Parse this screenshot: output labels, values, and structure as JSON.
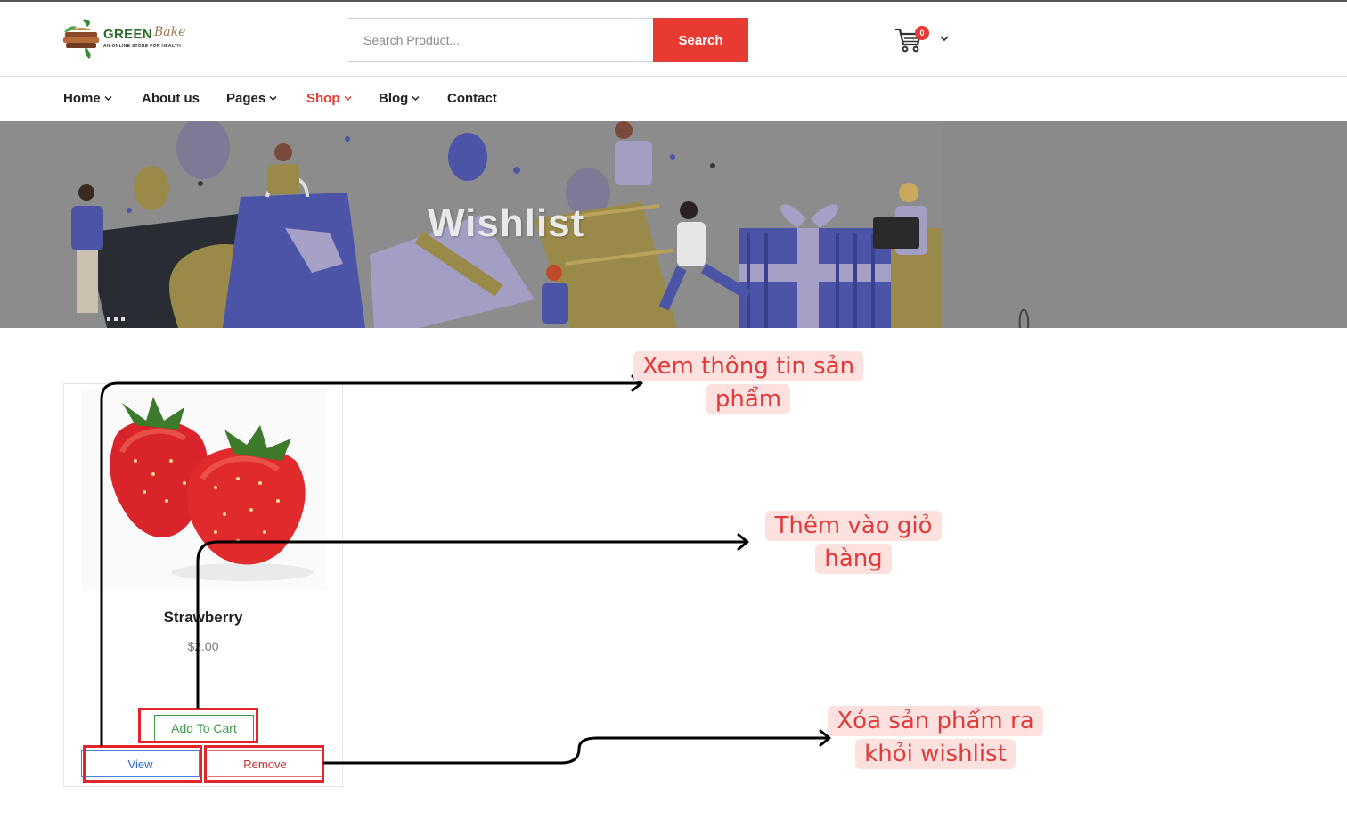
{
  "header": {
    "logo_text": "GREEN",
    "logo_script": "Bake",
    "logo_tagline": "AN ONLINE STORE FOR HEALTH",
    "search_placeholder": "Search Product...",
    "search_button": "Search",
    "cart_count": "0"
  },
  "nav": {
    "items": [
      {
        "label": "Home",
        "has_dropdown": true,
        "active": false
      },
      {
        "label": "About us",
        "has_dropdown": false,
        "active": false
      },
      {
        "label": "Pages",
        "has_dropdown": true,
        "active": false
      },
      {
        "label": "Shop",
        "has_dropdown": true,
        "active": true
      },
      {
        "label": "Blog",
        "has_dropdown": true,
        "active": false
      },
      {
        "label": "Contact",
        "has_dropdown": false,
        "active": false
      }
    ]
  },
  "banner": {
    "title": "Wishlist"
  },
  "wishlist": {
    "items": [
      {
        "name": "Strawberry",
        "price": "$2.00",
        "add_to_cart": "Add To Cart",
        "view": "View",
        "remove": "Remove"
      }
    ]
  },
  "annotations": {
    "view_note": "Xem thông tin sản phẩm",
    "add_note": "Thêm vào giỏ hàng",
    "remove_note": "Xóa sản phẩm ra khỏi wishlist"
  },
  "colors": {
    "accent_red": "#e63a32",
    "brand_green": "#2e6b2a",
    "callout_text": "#e23a3a",
    "callout_bg": "#fde1de"
  },
  "icons": {
    "cart": "cart-icon",
    "chevron": "chevron-down-icon",
    "logo": "logo-icon"
  }
}
